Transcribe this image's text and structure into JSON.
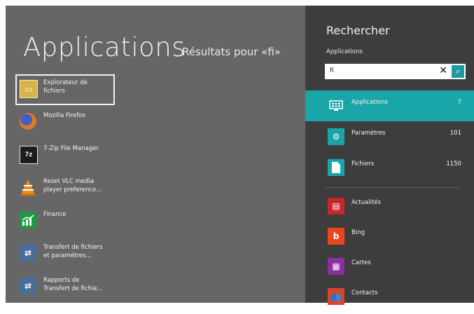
{
  "main": {
    "title": "Applications",
    "results_heading": "Résultats pour «fi»",
    "results": [
      {
        "label": "Explorateur de\nfichiers",
        "icon": "file-explorer-icon",
        "selected": true
      },
      {
        "label": "Mozilla Firefox",
        "icon": "firefox-icon",
        "selected": false
      },
      {
        "label": "7-Zip File Manager",
        "icon": "7zip-icon",
        "selected": false
      },
      {
        "label": "Reset VLC media\nplayer preference...",
        "icon": "vlc-icon",
        "selected": false
      },
      {
        "label": "Finance",
        "icon": "finance-icon",
        "selected": false
      },
      {
        "label": "Transfert de fichiers\net paramètres...",
        "icon": "easy-transfer-icon",
        "selected": false
      },
      {
        "label": "Rapports de\nTransfert de fichie...",
        "icon": "easy-transfer-icon",
        "selected": false
      }
    ]
  },
  "charm": {
    "title": "Rechercher",
    "scope": "Applications",
    "search_value": "fi",
    "clear_glyph": "✕",
    "go_glyph": "⌕",
    "scopes": [
      {
        "label": "Applications",
        "count": "7",
        "icon": "applications-icon",
        "active": true
      },
      {
        "label": "Paramètres",
        "count": "101",
        "icon": "settings-gear-icon",
        "active": false
      },
      {
        "label": "Fichiers",
        "count": "1150",
        "icon": "files-icon",
        "active": false
      }
    ],
    "apps": [
      {
        "label": "Actualités",
        "icon": "news-icon"
      },
      {
        "label": "Bing",
        "icon": "bing-icon"
      },
      {
        "label": "Cartes",
        "icon": "maps-icon"
      },
      {
        "label": "Contacts",
        "icon": "contacts-icon"
      }
    ]
  },
  "colors": {
    "background": "#666666",
    "charm_background": "#3d3d3d",
    "accent": "#1aa6a8"
  }
}
